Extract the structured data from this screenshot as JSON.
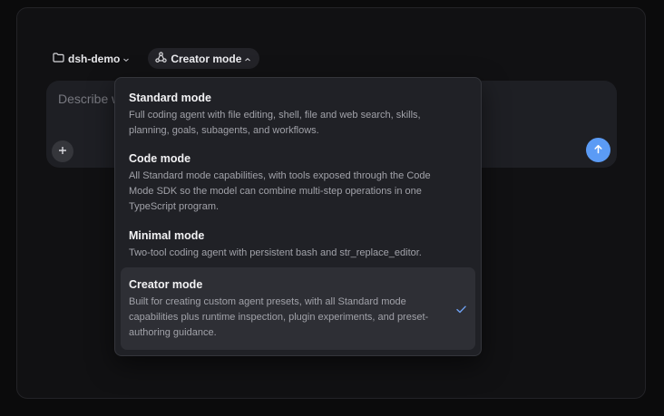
{
  "toolbar": {
    "folder": {
      "icon": "folder-icon",
      "label": "dsh-demo"
    },
    "mode": {
      "icon": "creator-mode-icon",
      "label": "Creator mode"
    }
  },
  "composer": {
    "placeholder": "Describe what you want to build",
    "add_icon": "plus-icon",
    "send_icon": "arrow-up-icon",
    "send_color": "#5b9bf5"
  },
  "mode_menu": {
    "items": [
      {
        "title": "Standard mode",
        "description": "Full coding agent with file editing, shell, file and web search, skills, planning, goals, subagents, and workflows."
      },
      {
        "title": "Code mode",
        "description": "All Standard mode capabilities, with tools exposed through the Code Mode SDK so the model can combine multi-step operations in one TypeScript program."
      },
      {
        "title": "Minimal mode",
        "description": "Two-tool coding agent with persistent bash and str_replace_editor."
      },
      {
        "title": "Creator mode",
        "description": "Built for creating custom agent presets, with all Standard mode capabilities plus runtime inspection, plugin experiments, and preset-authoring guidance.",
        "selected": true
      }
    ],
    "check_icon": "checkmark-icon",
    "check_color": "#6ea0f0"
  }
}
